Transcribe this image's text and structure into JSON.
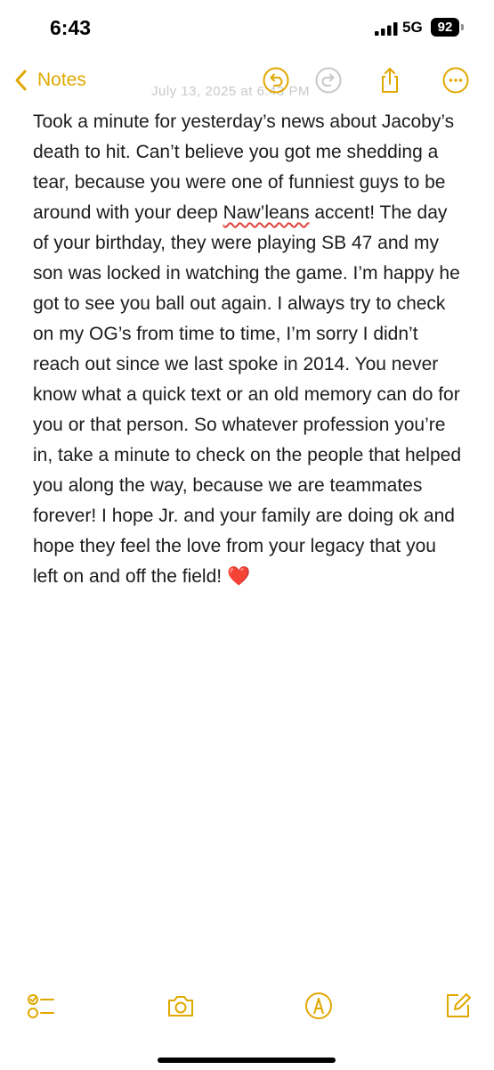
{
  "status_bar": {
    "time": "6:43",
    "network": "5G",
    "battery": "92"
  },
  "nav": {
    "back_label": "Notes",
    "faded_date": "July 13, 2025 at 6:43 PM",
    "icons": [
      "chevron-left-icon",
      "undo-icon",
      "redo-icon",
      "share-icon",
      "more-icon"
    ]
  },
  "note": {
    "text_before": "Took a minute for yesterday’s news about Jacoby’s death to hit. Can’t believe you got me shedding a tear, because you were one of funniest guys to be around with your deep ",
    "misspelled_word": "Naw’leans",
    "text_after": " accent! The day of your birthday, they were playing SB 47 and my son was locked in watching the game. I’m happy he got to see you ball out again. I always try to check on my OG’s from time to time, I’m sorry I didn’t reach out since we last spoke in 2014. You never know what a quick text or an old memory can do for you or that person. So whatever profession you’re in, take a minute to check on the people that helped you along the way, because we are teammates forever! I hope Jr. and your family are doing ok and hope they feel the love from your legacy that you left on and off the field! ",
    "emoji": "❤️"
  },
  "toolbar": {
    "icons": [
      "checklist-icon",
      "camera-icon",
      "markup-icon",
      "compose-icon"
    ]
  },
  "colors": {
    "accent": "#e0a800",
    "text": "#1c1c1e",
    "spellcheck": "#e0433c"
  }
}
